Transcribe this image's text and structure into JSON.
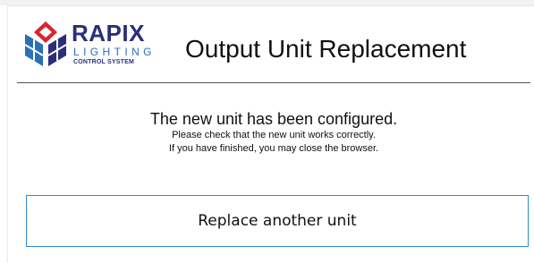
{
  "logo": {
    "brand": "RAPIX",
    "line2": "LIGHTING",
    "line3": "CONTROL SYSTEM",
    "colors": {
      "red": "#d7262b",
      "blue": "#2a6fb8",
      "navy": "#2a2f78"
    }
  },
  "header": {
    "title": "Output Unit Replacement"
  },
  "message": {
    "headline": "The new unit has been configured.",
    "line1": "Please check that the new unit works correctly.",
    "line2": "If you have finished, you may close the browser."
  },
  "actions": {
    "replace_label": "Replace another unit"
  },
  "colors": {
    "button_border": "#2f8ccd",
    "divider": "#555555"
  }
}
